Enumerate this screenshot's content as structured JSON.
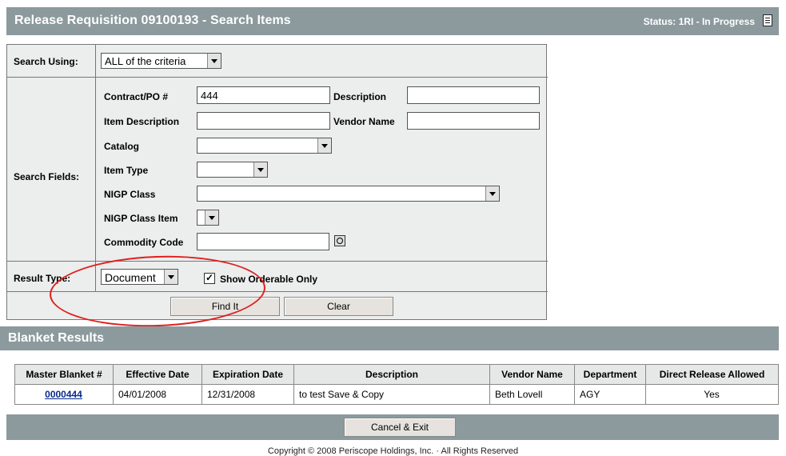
{
  "header": {
    "title": "Release Requisition 09100193 - Search Items",
    "status": "Status: 1RI - In Progress"
  },
  "search_using": {
    "label": "Search Using:",
    "value": "ALL of the criteria"
  },
  "search_fields": {
    "label": "Search Fields:",
    "contract_label": "Contract/PO #",
    "contract_value": "444",
    "description_label": "Description",
    "description_value": "",
    "item_desc_label": "Item Description",
    "item_desc_value": "",
    "vendor_name_label": "Vendor Name",
    "vendor_name_value": "",
    "catalog_label": "Catalog",
    "catalog_value": "",
    "item_type_label": "Item Type",
    "item_type_value": "",
    "nigp_class_label": "NIGP Class",
    "nigp_class_value": "",
    "nigp_item_label": "NIGP Class Item",
    "nigp_item_value": "",
    "commodity_label": "Commodity Code",
    "commodity_value": ""
  },
  "result_type": {
    "label": "Result Type:",
    "value": "Document",
    "orderable_label": "Show Orderable Only",
    "orderable_checked": true
  },
  "buttons": {
    "find": "Find It",
    "clear": "Clear",
    "cancel": "Cancel & Exit"
  },
  "results": {
    "title": "Blanket Results",
    "columns": [
      "Master Blanket #",
      "Effective Date",
      "Expiration Date",
      "Description",
      "Vendor Name",
      "Department",
      "Direct Release Allowed"
    ],
    "rows": [
      [
        "0000444",
        "04/01/2008",
        "12/31/2008",
        "to test Save & Copy",
        "Beth Lovell",
        "AGY",
        "Yes"
      ]
    ]
  },
  "footer": {
    "copyright": "Copyright © 2008 Periscope Holdings, Inc. · All Rights Reserved"
  },
  "colors": {
    "header_bg": "#8c9a9e",
    "link": "#0a2a8a",
    "annotation": "#e02020"
  }
}
